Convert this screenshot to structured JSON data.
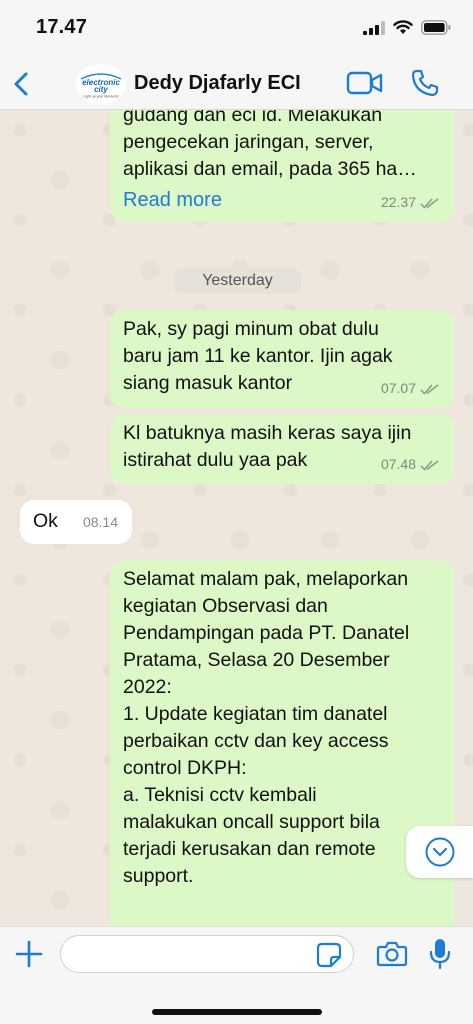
{
  "status_bar": {
    "time": "17.47"
  },
  "header": {
    "contact_name": "Dedy Djafarly ECI",
    "avatar_logo_text": "electronic city",
    "avatar_logo_tagline": "Light up your Moments"
  },
  "messages": [
    {
      "direction": "outgoing",
      "text": "gudang dan eci id. Melakukan\npengecekan jaringan, server,\naplikasi dan email, pada 365 ha…",
      "read_more": "Read more",
      "time": "22.37"
    },
    {
      "type": "date",
      "label": "Yesterday"
    },
    {
      "direction": "outgoing",
      "text": "Pak, sy pagi minum obat dulu\nbaru jam 11 ke kantor. Ijin agak\nsiang masuk kantor",
      "time": "07.07"
    },
    {
      "direction": "outgoing",
      "text": "Kl batuknya masih keras saya ijin\nistirahat dulu yaa pak",
      "time": "07.48"
    },
    {
      "direction": "incoming",
      "text": "Ok",
      "time": "08.14"
    },
    {
      "direction": "outgoing",
      "text": "Selamat malam pak, melaporkan\nkegiatan Observasi dan\nPendampingan pada PT. Danatel\nPratama, Selasa 20 Desember\n2022:\n1. Update kegiatan tim danatel\nperbaikan cctv dan key access\ncontrol DKPH:\na. Teknisi cctv kembali\nmalakukan oncall support bila\nterjadi kerusakan dan remote\nsupport."
    }
  ],
  "input": {
    "placeholder": "",
    "value": ""
  },
  "colors": {
    "accent": "#1e7bd6",
    "outgoing_bubble": "#dcf8c6",
    "incoming_bubble": "#ffffff",
    "chat_background": "#efe7dd"
  },
  "icons": {
    "back": "chevron-left-icon",
    "video": "video-camera-icon",
    "phone": "phone-icon",
    "attach": "plus-icon",
    "sticker": "sticker-icon",
    "camera": "camera-icon",
    "mic": "microphone-icon",
    "scroll": "chevron-down-icon",
    "read": "double-check-icon"
  }
}
